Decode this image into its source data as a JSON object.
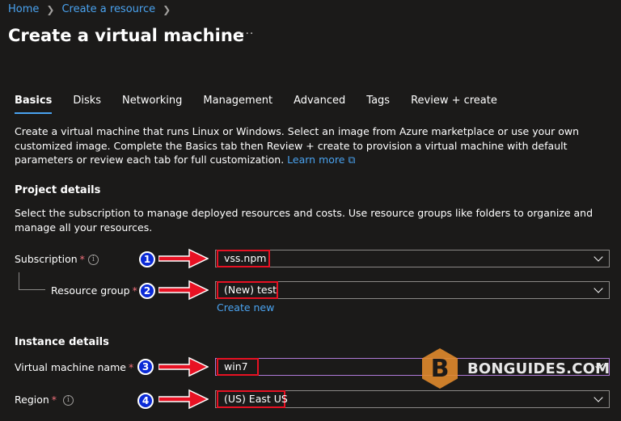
{
  "breadcrumb": {
    "home": "Home",
    "create_resource": "Create a resource"
  },
  "page": {
    "title": "Create a virtual machine",
    "more": "···"
  },
  "tabs": [
    {
      "label": "Basics",
      "active": true
    },
    {
      "label": "Disks"
    },
    {
      "label": "Networking"
    },
    {
      "label": "Management"
    },
    {
      "label": "Advanced"
    },
    {
      "label": "Tags"
    },
    {
      "label": "Review + create"
    }
  ],
  "intro": {
    "text": "Create a virtual machine that runs Linux or Windows. Select an image from Azure marketplace or use your own customized image. Complete the Basics tab then Review + create to provision a virtual machine with default parameters or review each tab for full customization.",
    "learn_more": "Learn more"
  },
  "project_details": {
    "title": "Project details",
    "description": "Select the subscription to manage deployed resources and costs. Use resource groups like folders to organize and manage all your resources.",
    "subscription": {
      "label": "Subscription",
      "value": "vss.npm"
    },
    "resource_group": {
      "label": "Resource group",
      "value": "(New) test",
      "create_new": "Create new"
    }
  },
  "instance_details": {
    "title": "Instance details",
    "vm_name": {
      "label": "Virtual machine name",
      "value": "win7"
    },
    "region": {
      "label": "Region",
      "value": "(US) East US"
    }
  },
  "required_mark": "*",
  "info_glyph": "i",
  "annotations": [
    "1",
    "2",
    "3",
    "4"
  ],
  "watermark": {
    "text": "BONGUIDES.COM",
    "logo_letter": "B"
  },
  "colors": {
    "accent": "#4aa3f0",
    "highlight": "#e81123",
    "badge": "#0a2ad6",
    "valid_border": "#b07ad8",
    "logo": "#e08a2c"
  }
}
